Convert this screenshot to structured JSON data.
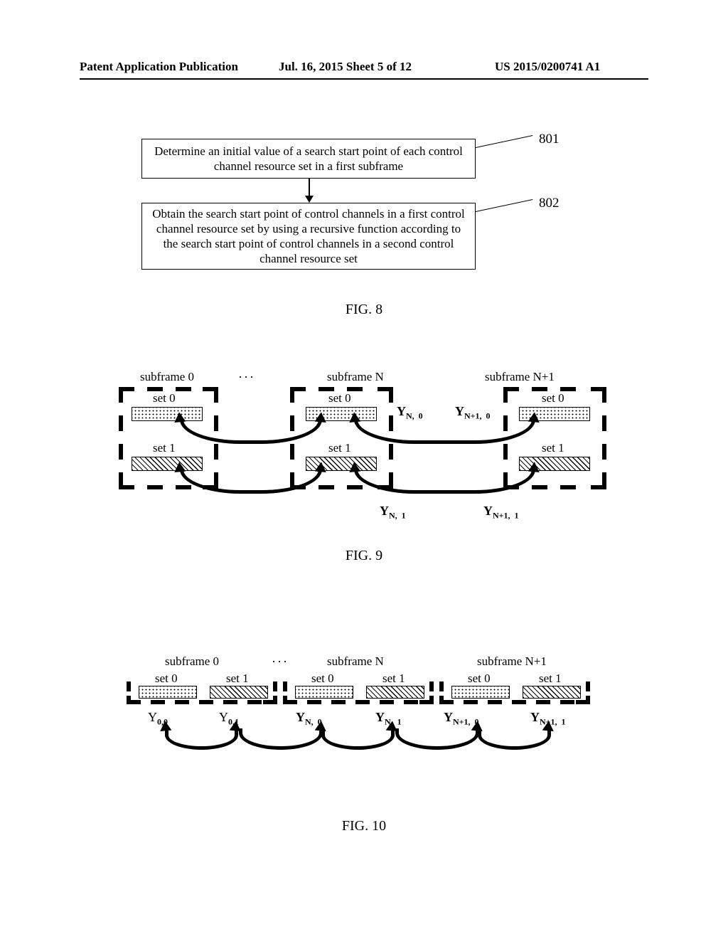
{
  "header": {
    "left": "Patent Application Publication",
    "mid": "Jul. 16, 2015  Sheet 5 of 12",
    "right": "US 2015/0200741 A1"
  },
  "fig8": {
    "box1": "Determine an initial value of a search start point of each control channel resource set in a first subframe",
    "box2": "Obtain the search start point of control channels in a first control channel resource set by using a recursive function according to the search start point of control channels in a second control channel resource set",
    "label1": "801",
    "label2": "802",
    "caption": "FIG. 8"
  },
  "fig9": {
    "sf0": "subframe 0",
    "sfN": "subframe N",
    "sfN1": "subframe N+1",
    "dots": "···",
    "set0": "set 0",
    "set1": "set 1",
    "y_n0": "Y<sub>N,&nbsp; 0</sub>",
    "y_n1_0": "Y<sub>N+1,&nbsp; 0</sub>",
    "y_n_1": "Y<sub>N,&nbsp; 1</sub>",
    "y_n1_1": "Y<sub>N+1,&nbsp; 1</sub>",
    "caption": "FIG. 9"
  },
  "fig10": {
    "sf0": "subframe 0",
    "sfN": "subframe N",
    "sfN1": "subframe N+1",
    "dots": "···",
    "set0": "set 0",
    "set1": "set 1",
    "y00": "Y<sub>0,0</sub>",
    "y01": "Y<sub>0,1</sub>",
    "y_n0": "Y<sub>N,&nbsp; 0</sub>",
    "y_n1": "Y<sub>N,&nbsp; 1</sub>",
    "y_n1_0": "Y<sub>N+1,&nbsp; 0</sub>",
    "y_n1_1": "Y<sub>N+1,&nbsp; 1</sub>",
    "caption": "FIG. 10"
  }
}
